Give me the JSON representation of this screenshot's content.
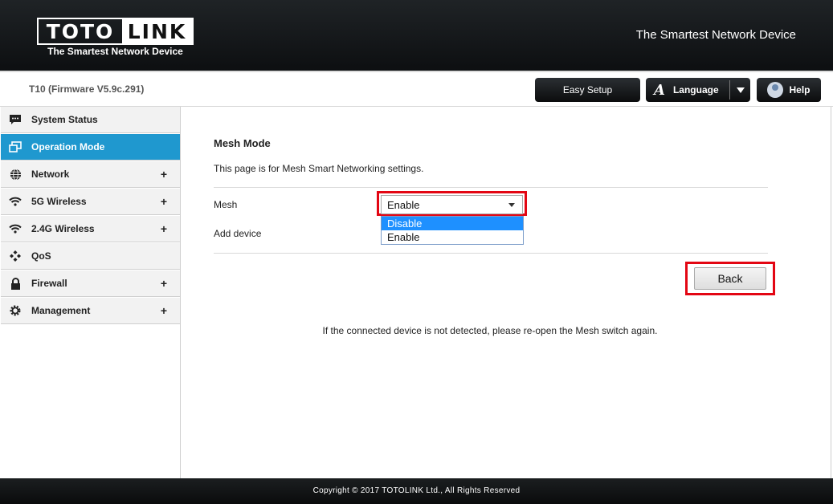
{
  "header": {
    "logo_left": "TOTO",
    "logo_right": "LINK",
    "logo_tagline": "The Smartest Network Device",
    "slogan": "The Smartest Network Device"
  },
  "toolbar": {
    "model": "T10 (Firmware V5.9c.291)",
    "easy_setup": "Easy Setup",
    "language_icon": "A",
    "language": "Language",
    "help": "Help"
  },
  "sidebar": {
    "items": [
      {
        "label": "System Status",
        "icon": "chat-bubble-icon",
        "expandable": false,
        "active": false
      },
      {
        "label": "Operation Mode",
        "icon": "windows-icon",
        "expandable": false,
        "active": true
      },
      {
        "label": "Network",
        "icon": "globe-icon",
        "expandable": true,
        "active": false
      },
      {
        "label": "5G Wireless",
        "icon": "wifi-icon",
        "expandable": true,
        "active": false
      },
      {
        "label": "2.4G Wireless",
        "icon": "wifi-icon",
        "expandable": true,
        "active": false
      },
      {
        "label": "QoS",
        "icon": "qos-icon",
        "expandable": false,
        "active": false
      },
      {
        "label": "Firewall",
        "icon": "lock-icon",
        "expandable": true,
        "active": false
      },
      {
        "label": "Management",
        "icon": "gear-icon",
        "expandable": true,
        "active": false
      }
    ],
    "plus": "+"
  },
  "main": {
    "title": "Mesh Mode",
    "description": "This page is for Mesh Smart Networking settings.",
    "mesh_label": "Mesh",
    "mesh_value": "Enable",
    "mesh_options": [
      "Disable",
      "Enable"
    ],
    "mesh_highlighted_option": "Disable",
    "add_device_label": "Add device",
    "back_button": "Back",
    "note": "If the connected device is not detected, please re-open the Mesh switch again."
  },
  "footer": {
    "copyright": "Copyright © 2017 TOTOLINK Ltd.,   All Rights Reserved"
  },
  "colors": {
    "active_nav": "#1f98cf",
    "highlight_box": "#e30613",
    "dropdown_selected": "#1e90ff"
  }
}
